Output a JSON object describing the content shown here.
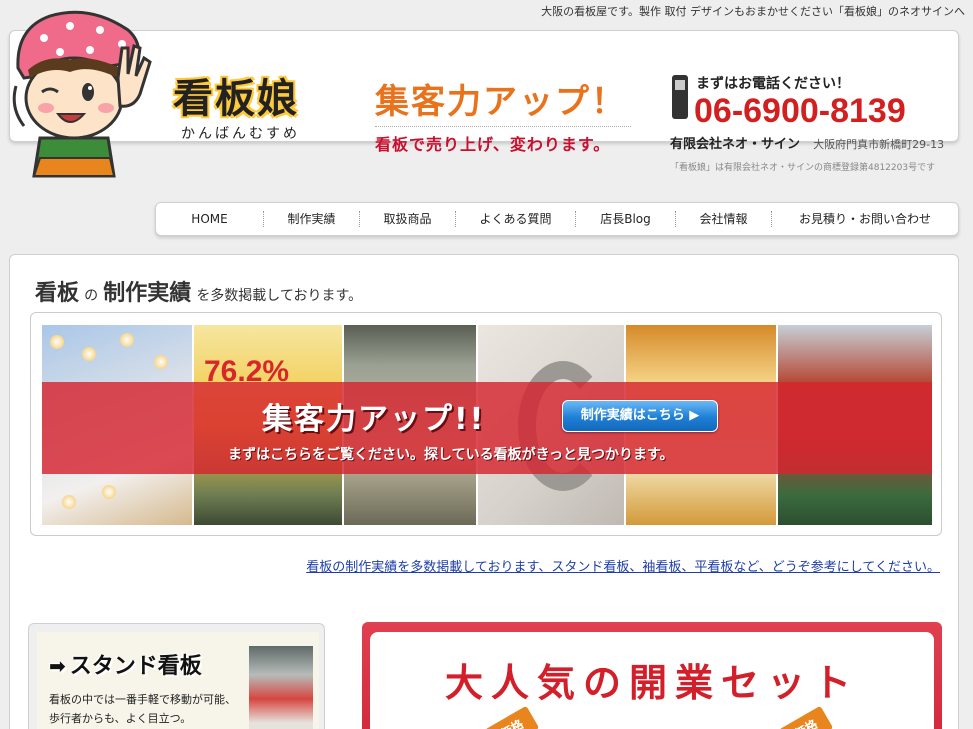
{
  "topline": "大阪の看板屋です。製作 取付 デザインもおまかせください「看板娘」のネオサインへ",
  "header": {
    "brand_title": "看板娘",
    "brand_sub": "かんばんむすめ",
    "catch_main": "集客力アップ！",
    "catch_sub": "看板で売り上げ、変わります。",
    "contact_lead": "まずはお電話ください！",
    "phone": "06-6900-8139",
    "company": "有限会社ネオ・サイン",
    "address": "大阪府門真市新橋町29-13",
    "trademark": "「看板娘」は有限会社ネオ・サインの商標登録第4812203号です"
  },
  "nav": {
    "items": [
      {
        "label": "HOME"
      },
      {
        "label": "制作実績"
      },
      {
        "label": "取扱商品"
      },
      {
        "label": "よくある質問"
      },
      {
        "label": "店長Blog"
      },
      {
        "label": "会社情報"
      },
      {
        "label": "お見積り・お問い合わせ"
      }
    ]
  },
  "works": {
    "heading_part1": "看板",
    "heading_part2": "の",
    "heading_part3": "制作実績",
    "heading_part4": "を多数掲載しております。",
    "banner_title": "集客力アップ!!",
    "banner_button": "制作実績はこちら ▶",
    "banner_sub": "まずはこちらをご覧ください。探している看板がきっと見つかります。",
    "photo_text": "76.2%",
    "link_text": "看板の制作実績を多数掲載しております、スタンド看板、袖看板、平看板など、どうぞ参考にしてください。"
  },
  "stand": {
    "arrow": "➡",
    "title": "スタンド看板",
    "description": "看板の中では一番手軽で移動が可能、歩行者からも、よく目立つ。"
  },
  "promo": {
    "title": "大人気の開業セット",
    "price_label": "価格"
  },
  "colors": {
    "accent_red": "#d21f1f",
    "catch_orange": "#e8731c",
    "link_blue": "#1f3fa8",
    "brand_yellow": "#ffc93a"
  }
}
